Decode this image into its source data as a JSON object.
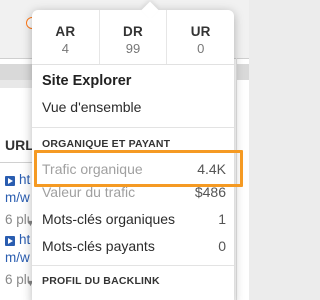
{
  "background": {
    "column_header": "URL",
    "rows": [
      {
        "link_top": "ht",
        "link_bottom": "m/w",
        "extra": "6 plu"
      },
      {
        "link_top": "ht",
        "link_bottom": "m/w",
        "extra": "6 plu"
      }
    ]
  },
  "metrics": [
    {
      "label": "AR",
      "value": "4"
    },
    {
      "label": "DR",
      "value": "99"
    },
    {
      "label": "UR",
      "value": "0"
    }
  ],
  "menu": {
    "site_explorer": "Site Explorer",
    "overview": "Vue d'ensemble",
    "section_organic": "ORGANIQUE ET PAYANT",
    "items": [
      {
        "label": "Trafic organique",
        "value": "4.4K",
        "muted": true
      },
      {
        "label": "Valeur du trafic",
        "value": "$486",
        "muted": false
      },
      {
        "label": "Mots-clés organiques",
        "value": "1",
        "muted": false
      },
      {
        "label": "Mots-clés payants",
        "value": "0",
        "muted": false
      }
    ],
    "section_backlinks": "PROFIL DU BACKLINK"
  },
  "colors": {
    "highlight": "#f59a23",
    "link": "#2a5db0"
  }
}
